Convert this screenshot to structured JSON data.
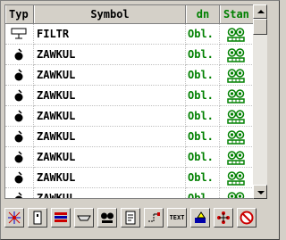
{
  "table": {
    "headers": {
      "typ": "Typ",
      "symbol": "Symbol",
      "dn": "dn",
      "stan": "Stan"
    },
    "rows": [
      {
        "type_icon": "filter-icon",
        "symbol": "FILTR",
        "dn": "Obl.",
        "status_icon": "status-ok-icon"
      },
      {
        "type_icon": "valve-icon",
        "symbol": "ZAWKUL",
        "dn": "Obl.",
        "status_icon": "status-ok-icon"
      },
      {
        "type_icon": "valve-icon",
        "symbol": "ZAWKUL",
        "dn": "Obl.",
        "status_icon": "status-ok-icon"
      },
      {
        "type_icon": "valve-icon",
        "symbol": "ZAWKUL",
        "dn": "Obl.",
        "status_icon": "status-ok-icon"
      },
      {
        "type_icon": "valve-icon",
        "symbol": "ZAWKUL",
        "dn": "Obl.",
        "status_icon": "status-ok-icon"
      },
      {
        "type_icon": "valve-icon",
        "symbol": "ZAWKUL",
        "dn": "Obl.",
        "status_icon": "status-ok-icon"
      },
      {
        "type_icon": "valve-icon",
        "symbol": "ZAWKUL",
        "dn": "Obl.",
        "status_icon": "status-ok-icon"
      },
      {
        "type_icon": "valve-icon",
        "symbol": "ZAWKUL",
        "dn": "Obl.",
        "status_icon": "status-ok-icon"
      },
      {
        "type_icon": "valve-icon",
        "symbol": "ZAWKUL",
        "dn": "Obl.",
        "status_icon": "status-ok-icon"
      }
    ]
  },
  "toolbar": {
    "buttons": [
      "network-icon",
      "fitting-icon",
      "flags-icon",
      "pipe-icon",
      "pump-icon",
      "document-icon",
      "connector-icon",
      "text-icon",
      "paint-icon",
      "nodes-icon",
      "no-entry-icon"
    ],
    "text_button_label": "TEXT"
  },
  "colors": {
    "accent_green": "#008000",
    "header_bg": "#d4d0c8"
  }
}
